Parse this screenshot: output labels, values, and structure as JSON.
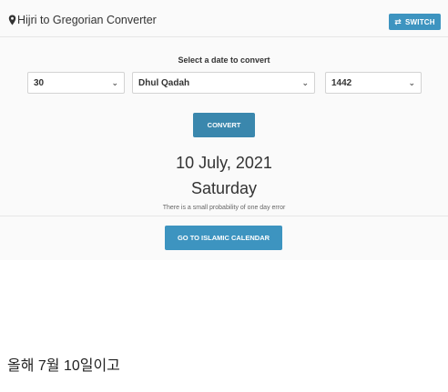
{
  "header": {
    "title": "Hijri to Gregorian Converter",
    "switch_label": "SWITCH"
  },
  "form": {
    "prompt": "Select a date to convert",
    "day": "30",
    "month": "Dhul Qadah",
    "year": "1442",
    "convert_label": "CONVERT"
  },
  "result": {
    "date": "10 July, 2021",
    "weekday": "Saturday",
    "note": "There is a small probability of one day error"
  },
  "calendar_label": "GO TO ISLAMIC CALENDAR",
  "caption": "올해 7월 10일이고",
  "colors": {
    "button": "#3d94c0",
    "button_dark": "#3a87ad"
  }
}
